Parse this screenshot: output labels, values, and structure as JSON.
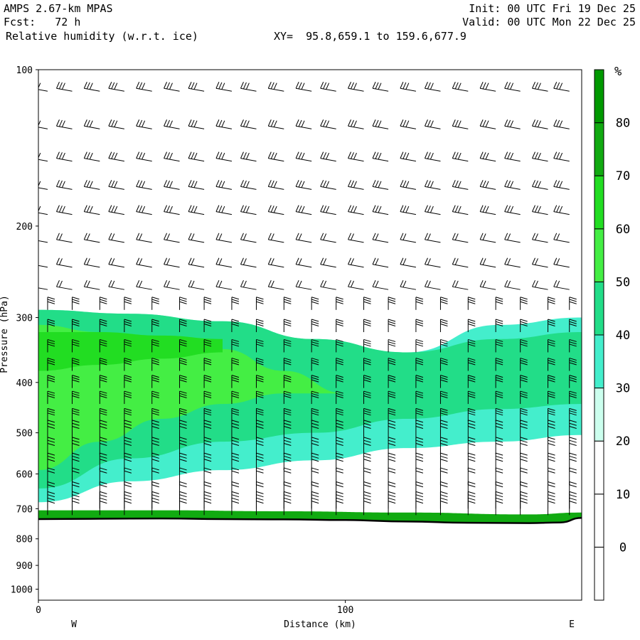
{
  "header": {
    "model": "AMPS 2.67-km MPAS",
    "fcst_label": "Fcst:",
    "fcst_value": "72 h",
    "field": "Relative humidity (w.r.t. ice)",
    "xy_label": "XY=",
    "xy_value": "95.8,659.1 to 159.6,677.9",
    "init": "Init: 00 UTC Fri 19 Dec 25",
    "valid": "Valid: 00 UTC Mon 22 Dec 25"
  },
  "chart_data": {
    "type": "heatmap",
    "subtype": "vertical cross-section with wind barbs",
    "ylabel": "Pressure (hPa)",
    "xlabel": "Distance (km)",
    "y_scale": "log-pressure (inverted)",
    "ylim": [
      1050,
      100
    ],
    "xlim": [
      0,
      177
    ],
    "y_ticks": [
      100,
      200,
      300,
      400,
      500,
      600,
      700,
      800,
      900,
      1000
    ],
    "x_ticks": [
      0,
      100
    ],
    "x_end_labels": {
      "left": "W",
      "right": "E"
    },
    "colorbar": {
      "unit": "%",
      "levels": [
        0,
        10,
        20,
        30,
        40,
        50,
        60,
        70,
        80
      ],
      "colors": [
        "#ffffff",
        "#ffffff",
        "#ffffff",
        "#ccffee",
        "#44eecc",
        "#22dd88",
        "#44ee44",
        "#22dd22",
        "#11aa11",
        "#009900"
      ]
    },
    "terrain_pressure": {
      "x_km": [
        0,
        20,
        40,
        60,
        80,
        100,
        120,
        140,
        160,
        170,
        177
      ],
      "p_hpa": [
        733,
        732,
        731,
        733,
        734,
        736,
        741,
        745,
        746,
        744,
        729
      ]
    },
    "rh_layers": [
      {
        "range": "30-40",
        "level": 30,
        "top": {
          "x_km": [
            0,
            30,
            60,
            90,
            120,
            150,
            177
          ],
          "p_hpa": [
            290,
            295,
            305,
            330,
            350,
            310,
            300
          ]
        },
        "bottom": {
          "x_km": [
            0,
            30,
            60,
            90,
            120,
            150,
            177
          ],
          "p_hpa": [
            680,
            620,
            590,
            565,
            535,
            520,
            505
          ]
        }
      },
      {
        "range": "40-50",
        "level": 40,
        "top": {
          "x_km": [
            0,
            30,
            60,
            90,
            120,
            150,
            177
          ],
          "p_hpa": [
            290,
            295,
            305,
            330,
            350,
            330,
            320
          ]
        },
        "bottom": {
          "x_km": [
            0,
            30,
            60,
            90,
            120,
            150,
            177
          ],
          "p_hpa": [
            640,
            560,
            520,
            500,
            470,
            450,
            440
          ]
        }
      },
      {
        "range": "50-60",
        "level": 50,
        "top": {
          "x_km": [
            0,
            20,
            40,
            60,
            80,
            100
          ],
          "p_hpa": [
            310,
            320,
            330,
            345,
            380,
            420
          ]
        },
        "bottom": {
          "x_km": [
            0,
            20,
            40,
            60,
            80,
            100
          ],
          "p_hpa": [
            590,
            520,
            470,
            440,
            420,
            420
          ]
        }
      },
      {
        "range": "60-70",
        "level": 60,
        "top": {
          "x_km": [
            0,
            20,
            40,
            60
          ],
          "p_hpa": [
            320,
            320,
            325,
            330
          ]
        },
        "bottom": {
          "x_km": [
            0,
            20,
            40,
            60
          ],
          "p_hpa": [
            380,
            370,
            360,
            350
          ]
        }
      },
      {
        "range": "70-80 (near surface)",
        "level": 70,
        "top": {
          "x_km": [
            0,
            40,
            80,
            120,
            160,
            177
          ],
          "p_hpa": [
            705,
            705,
            708,
            712,
            718,
            712
          ]
        },
        "bottom": "terrain"
      }
    ],
    "wind_barbs": {
      "x_km": [
        3,
        11,
        20,
        28,
        37,
        46,
        54,
        63,
        71,
        80,
        89,
        97,
        106,
        114,
        123,
        131,
        140,
        149,
        157,
        166,
        173
      ],
      "levels_hpa": [
        110,
        130,
        150,
        170,
        190,
        215,
        240,
        265,
        290,
        320,
        350,
        380,
        410,
        440,
        475,
        510,
        550,
        590,
        630,
        670,
        700,
        720
      ],
      "direction_upper": "westerly, strong (pennants aloft)",
      "direction_lower": "northerly, weakening toward surface"
    }
  }
}
